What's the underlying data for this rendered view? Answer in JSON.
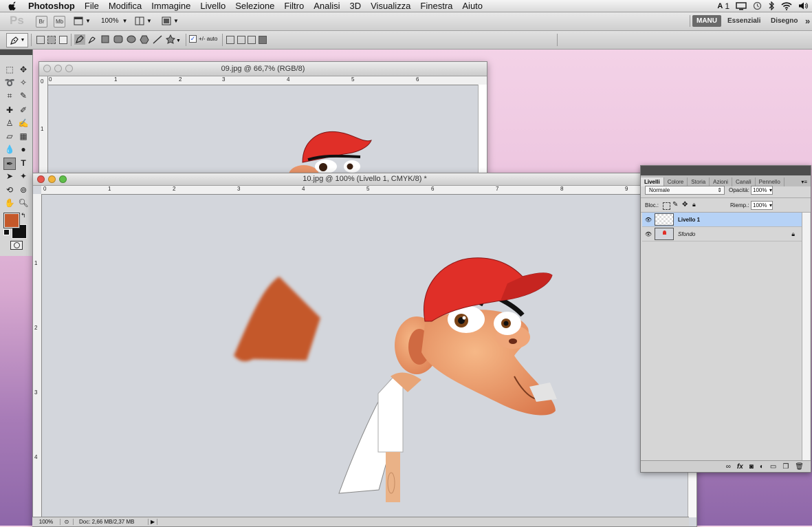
{
  "menubar": {
    "app_name": "Photoshop",
    "items": [
      "File",
      "Modifica",
      "Immagine",
      "Livello",
      "Selezione",
      "Filtro",
      "Analisi",
      "3D",
      "Visualizza",
      "Finestra",
      "Aiuto"
    ],
    "status_badge": "1"
  },
  "appbar": {
    "logo": "Ps",
    "bridge": "Br",
    "minibridge": "Mb",
    "zoom": "100%",
    "workspaces": [
      "MANU",
      "Essenziali",
      "Disegno"
    ],
    "more": "»"
  },
  "options": {
    "auto_add_delete": "+/- auto"
  },
  "back_window": {
    "title": "09.jpg @ 66,7% (RGB/8)",
    "ruler_h": [
      "0",
      "1",
      "2",
      "3",
      "4",
      "5",
      "6"
    ],
    "ruler_v": [
      "0",
      "1"
    ]
  },
  "front_window": {
    "title": "10.jpg @ 100% (Livello 1, CMYK/8) *",
    "ruler_h": [
      "0",
      "1",
      "2",
      "3",
      "4",
      "5",
      "6",
      "7",
      "8",
      "9"
    ],
    "ruler_v": [
      "1",
      "2",
      "3",
      "4"
    ],
    "zoom": "100%",
    "doc_info": "Doc: 2,66 MB/2,37 MB"
  },
  "layers_panel": {
    "tabs": [
      "Livelli",
      "Colore",
      "Storia",
      "Azioni",
      "Canali",
      "Pennello"
    ],
    "blend_mode": "Normale",
    "opacity_label": "Opacità:",
    "opacity_value": "100%",
    "lock_label": "Bloc.:",
    "fill_label": "Riemp.:",
    "fill_value": "100%",
    "layers": [
      {
        "name": "Livello 1",
        "selected": true
      },
      {
        "name": "Sfondo",
        "selected": false,
        "locked": true
      }
    ]
  },
  "colors": {
    "foreground": "#c4582a",
    "background": "#111111",
    "canvas": "#d3d6dc",
    "selection": "#b6d2f6"
  }
}
